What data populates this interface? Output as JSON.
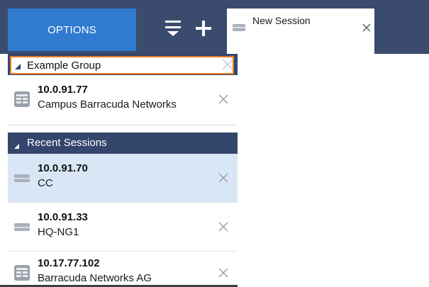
{
  "toolbar": {
    "options_label": "OPTIONS",
    "filter_icon": "filter-icon",
    "add_icon": "plus-icon"
  },
  "tab": {
    "label": "New Session",
    "icon": "session-icon",
    "close_icon": "close-icon"
  },
  "group": {
    "name_value": "Example Group",
    "items": [
      {
        "ip": "10.0.91.77",
        "desc": "Campus Barracuda Networks",
        "icon": "server-grid-icon"
      }
    ]
  },
  "recent": {
    "header": "Recent Sessions",
    "items": [
      {
        "ip": "10.0.91.70",
        "desc": "CC",
        "icon": "appliance-icon",
        "selected": true
      },
      {
        "ip": "10.0.91.33",
        "desc": "HQ-NG1",
        "icon": "appliance-icon",
        "selected": false
      },
      {
        "ip": "10.17.77.102",
        "desc": "Barracuda Networks AG",
        "icon": "server-grid-icon",
        "selected": false
      }
    ]
  },
  "colors": {
    "topbar": "#3a4b6e",
    "options_tab": "#2f7bd0",
    "header": "#34466b",
    "selected_row": "#d9e6f5",
    "input_border": "#e57a26"
  }
}
